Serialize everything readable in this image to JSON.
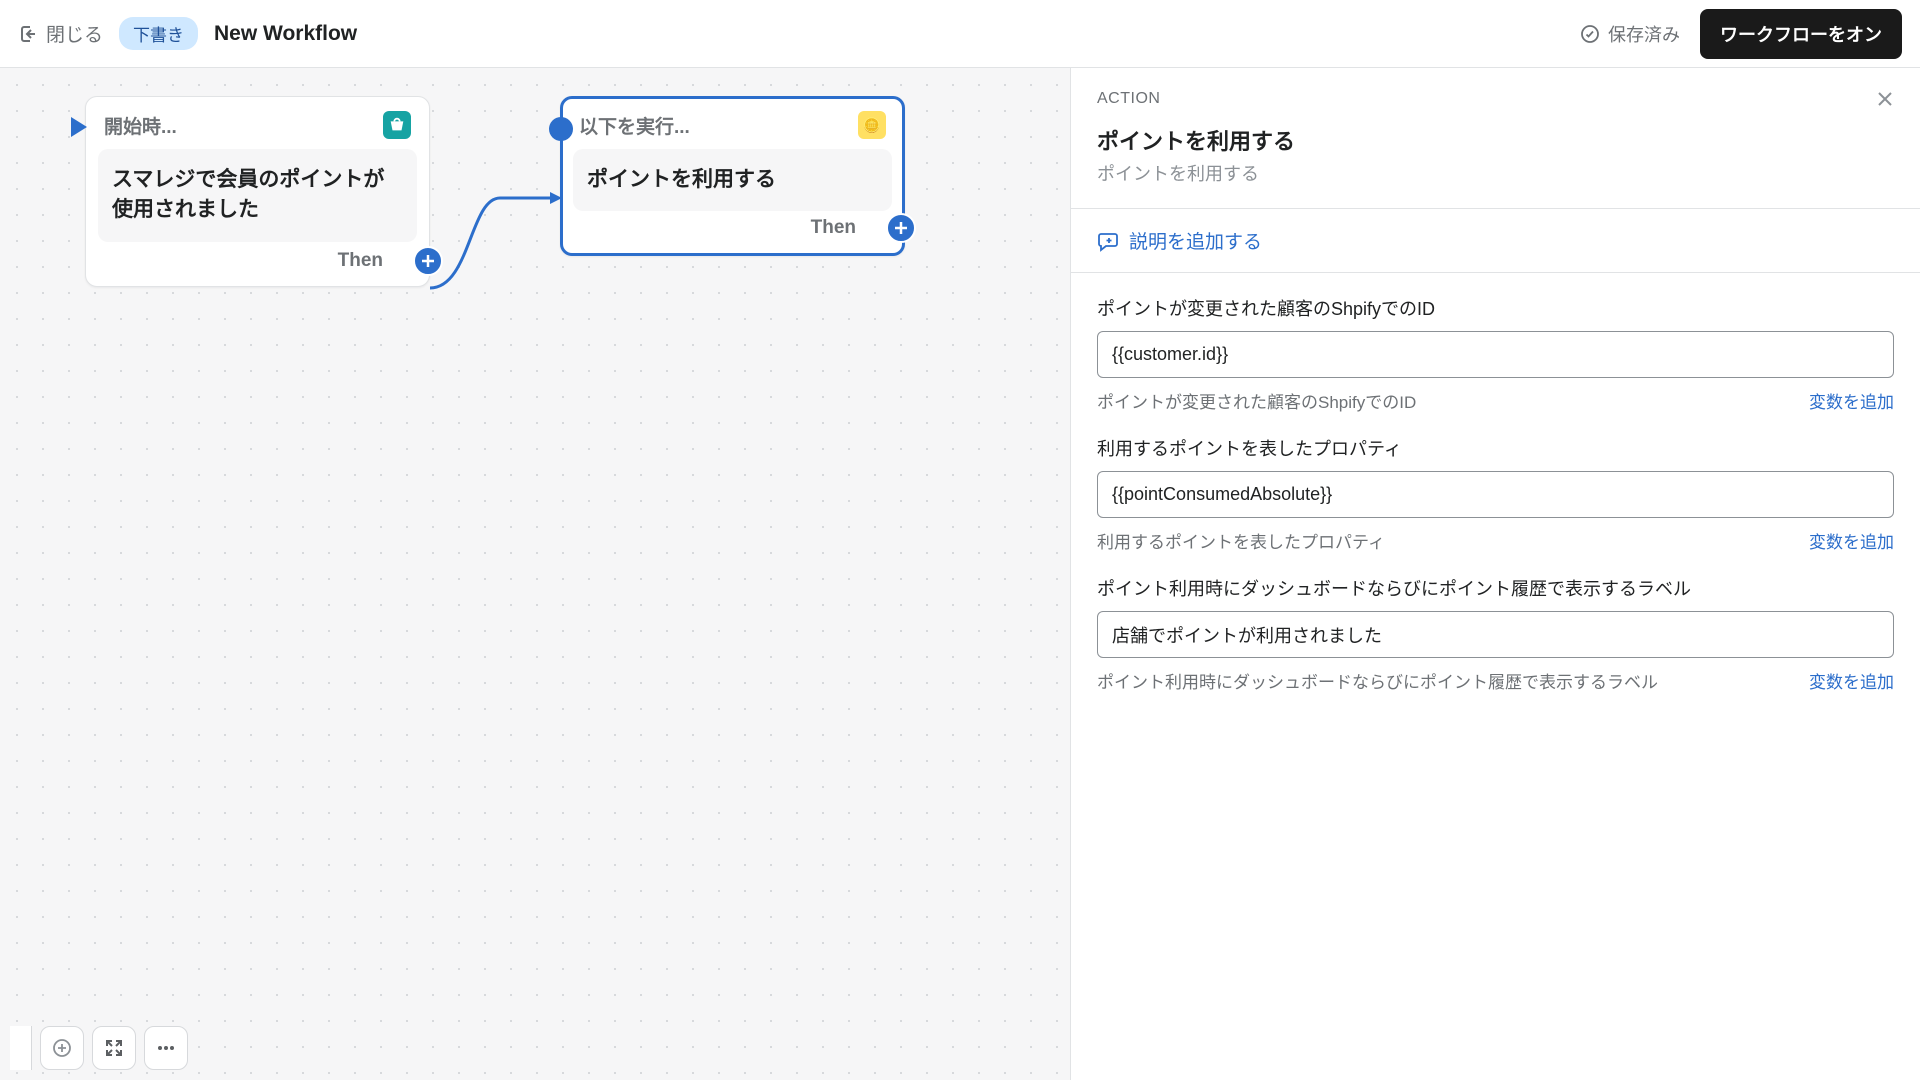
{
  "topbar": {
    "close_label": "閉じる",
    "draft_badge": "下書き",
    "workflow_title": "New Workflow",
    "saved_label": "保存済み",
    "turn_on_label": "ワークフローをオン"
  },
  "canvas": {
    "trigger": {
      "header": "開始時...",
      "body": "スマレジで会員のポイントが使用されました",
      "then_label": "Then"
    },
    "action": {
      "header": "以下を実行...",
      "body": "ポイントを利用する",
      "then_label": "Then"
    }
  },
  "panel": {
    "type_label": "ACTION",
    "title": "ポイントを利用する",
    "subtitle": "ポイントを利用する",
    "add_description_label": "説明を追加する",
    "fields": [
      {
        "label": "ポイントが変更された顧客のShpifyでのID",
        "value": "{{customer.id}}",
        "hint": "ポイントが変更された顧客のShpifyでのID",
        "add_var": "変数を追加"
      },
      {
        "label": "利用するポイントを表したプロパティ",
        "value": "{{pointConsumedAbsolute}}",
        "hint": "利用するポイントを表したプロパティ",
        "add_var": "変数を追加"
      },
      {
        "label": "ポイント利用時にダッシュボードならびにポイント履歴で表示するラベル",
        "value": "店舗でポイントが利用されました",
        "hint": "ポイント利用時にダッシュボードならびにポイント履歴で表示するラベル",
        "add_var": "変数を追加"
      }
    ]
  }
}
